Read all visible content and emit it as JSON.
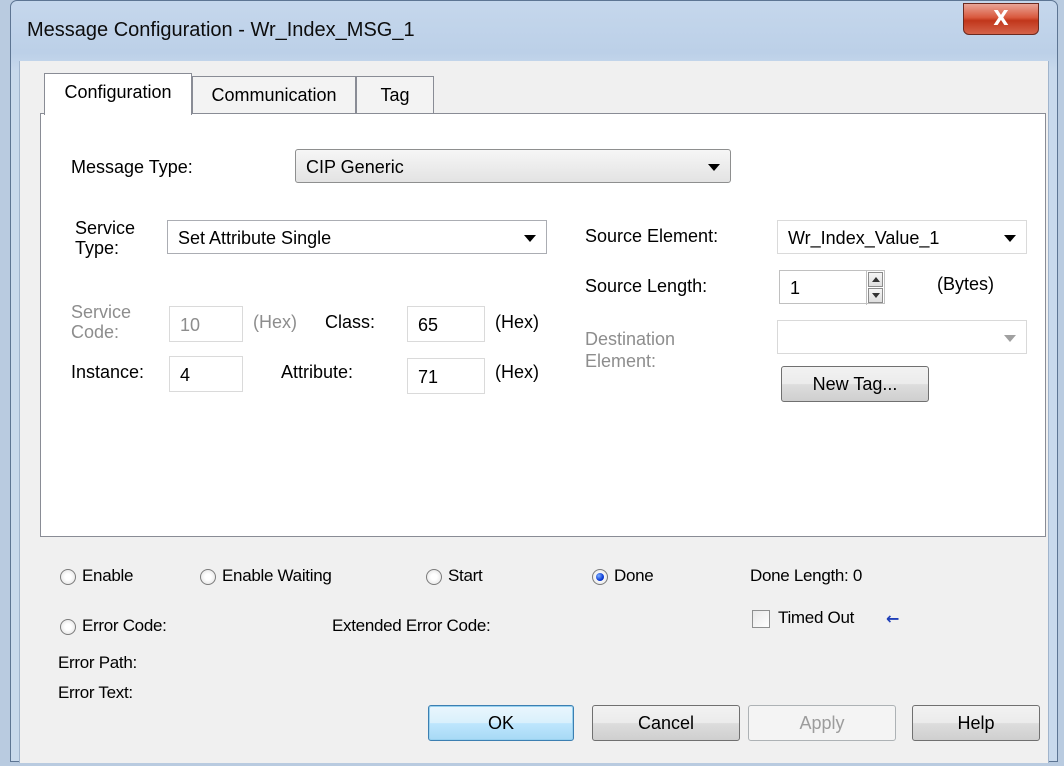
{
  "window": {
    "title": "Message Configuration - Wr_Index_MSG_1",
    "close_glyph": "X"
  },
  "tabs": [
    {
      "label": "Configuration",
      "active": true
    },
    {
      "label": "Communication",
      "active": false
    },
    {
      "label": "Tag",
      "active": false
    }
  ],
  "config": {
    "message_type_label": "Message Type:",
    "message_type_value": "CIP Generic",
    "service_type_label_1": "Service",
    "service_type_label_2": "Type:",
    "service_type_value": "Set Attribute Single",
    "service_code_label_1": "Service",
    "service_code_label_2": "Code:",
    "service_code_value": "10",
    "service_code_unit": "(Hex)",
    "class_label": "Class:",
    "class_value": "65",
    "class_unit": "(Hex)",
    "instance_label": "Instance:",
    "instance_value": "4",
    "attribute_label": "Attribute:",
    "attribute_value": "71",
    "attribute_unit": "(Hex)",
    "source_element_label": "Source Element:",
    "source_element_value": "Wr_Index_Value_1",
    "source_length_label": "Source Length:",
    "source_length_value": "1",
    "source_length_unit": "(Bytes)",
    "destination_label_1": "Destination",
    "destination_label_2": "Element:",
    "destination_value": "",
    "new_tag_label": "New Tag..."
  },
  "status": {
    "enable": "Enable",
    "enable_waiting": "Enable Waiting",
    "start": "Start",
    "done": "Done",
    "done_length": "Done Length: 0",
    "error_code": "Error Code:",
    "extended_error_code": "Extended Error Code:",
    "timed_out": "Timed Out",
    "error_path": "Error Path:",
    "error_text": "Error Text:",
    "selected": "done"
  },
  "buttons": {
    "ok": "OK",
    "cancel": "Cancel",
    "apply": "Apply",
    "help": "Help"
  },
  "icons": {
    "timed_out_arrow": "left-arrow-icon",
    "close": "close-icon"
  }
}
